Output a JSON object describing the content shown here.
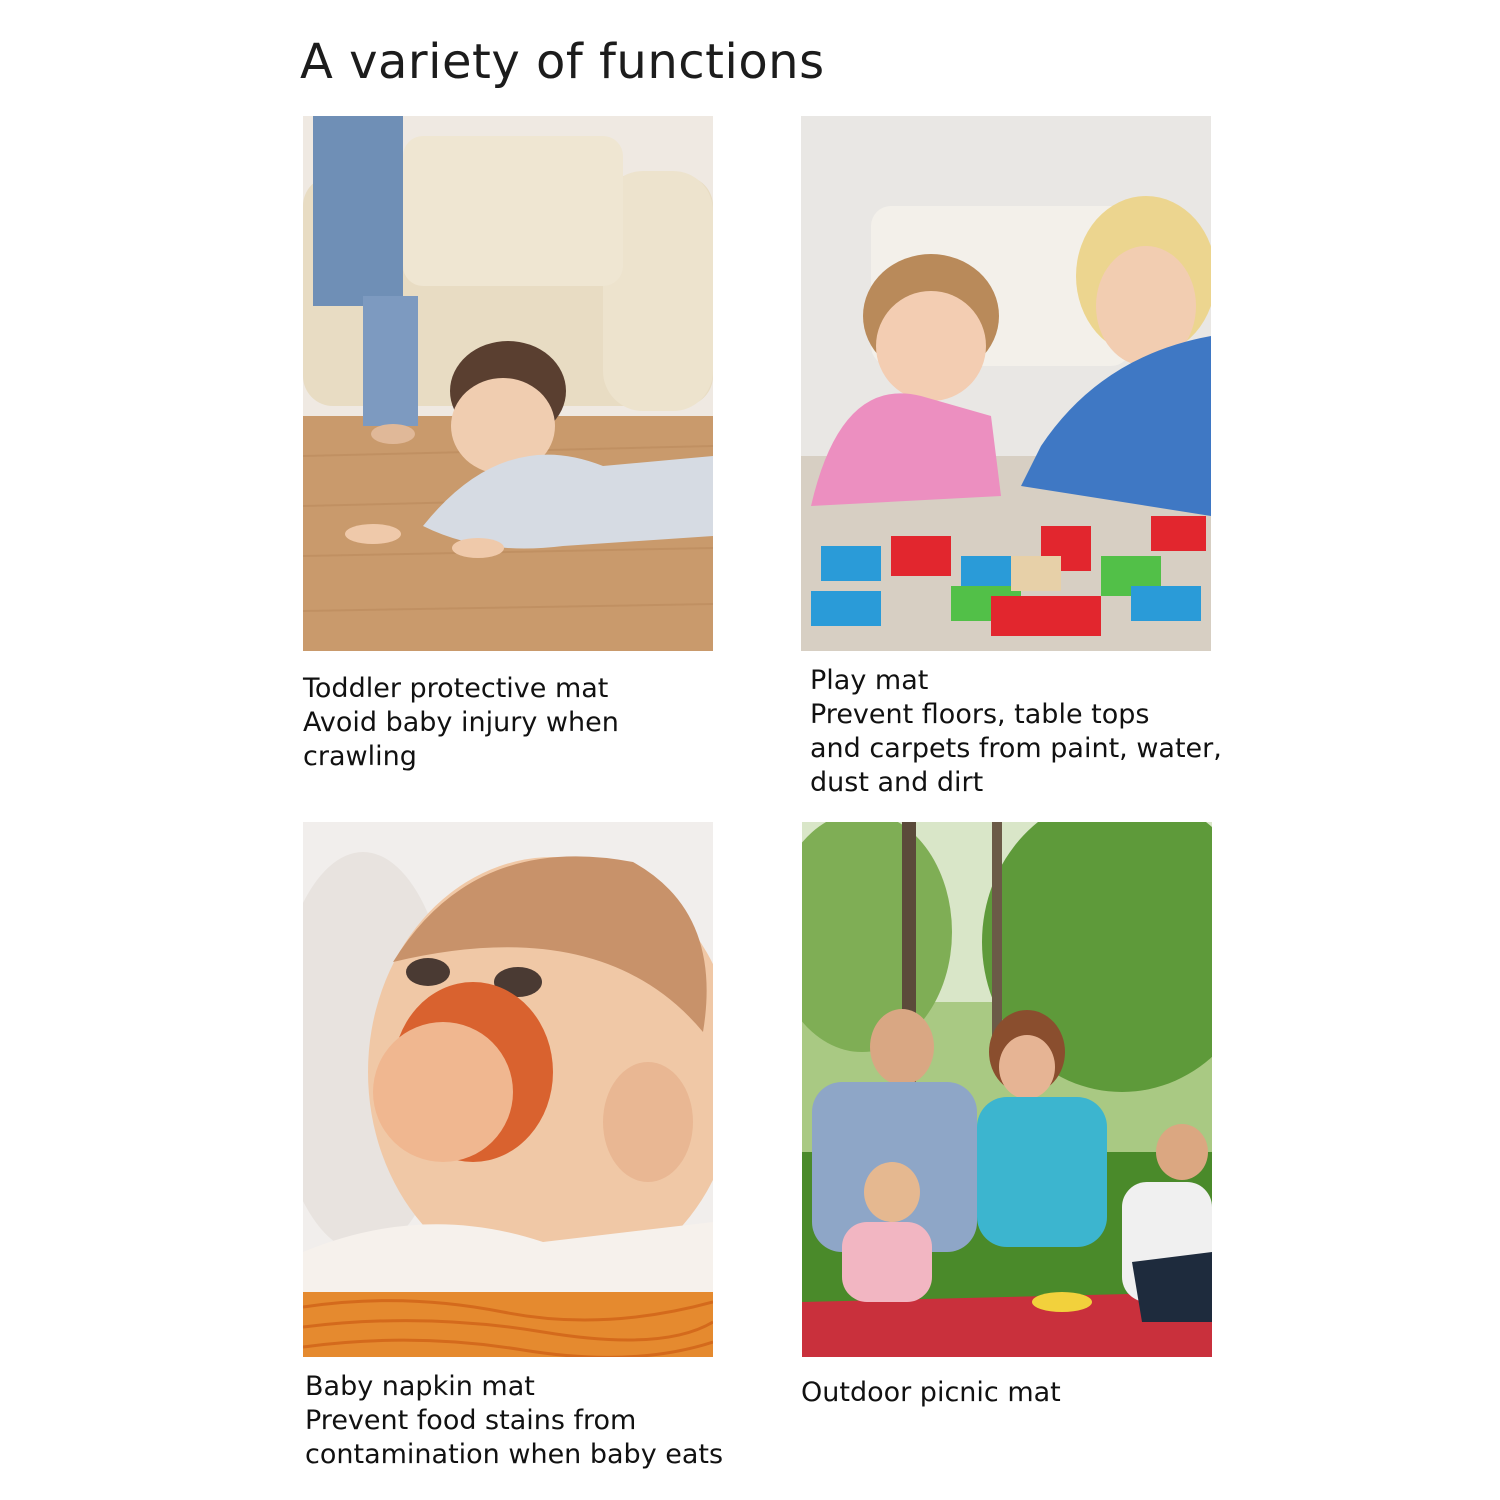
{
  "page": {
    "title": "A variety of functions"
  },
  "panels": [
    {
      "image": "baby-crawling-photo",
      "caption": [
        "Toddler protective mat",
        "Avoid baby injury when",
        "crawling"
      ]
    },
    {
      "image": "play-blocks-photo",
      "caption": [
        "Play mat",
        "Prevent floors, table tops",
        "and carpets from paint, water,",
        "dust and dirt"
      ]
    },
    {
      "image": "baby-eating-spaghetti-photo",
      "caption": [
        "Baby napkin mat",
        "Prevent food stains from",
        "contamination when baby eats"
      ]
    },
    {
      "image": "family-picnic-photo",
      "caption": [
        "Outdoor picnic mat"
      ]
    }
  ]
}
